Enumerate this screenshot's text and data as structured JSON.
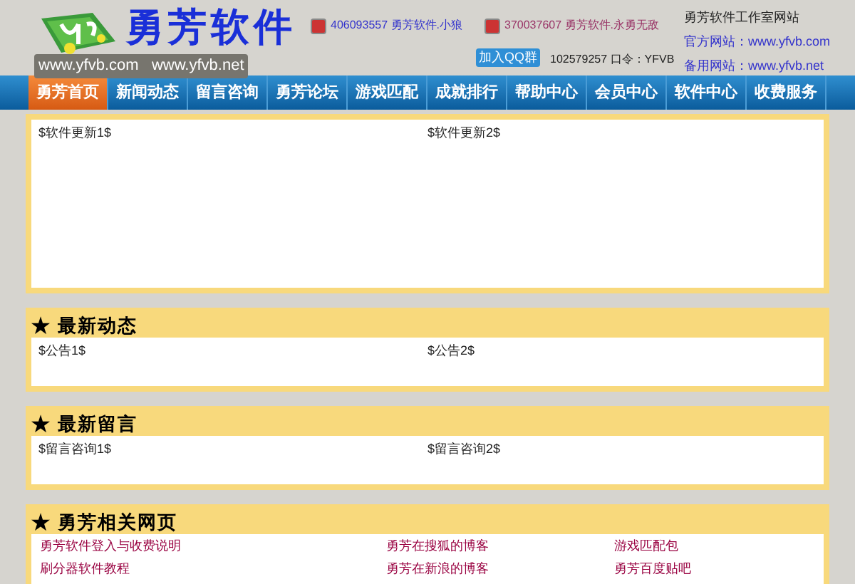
{
  "header": {
    "brand": "勇芳软件",
    "domains": "www.yfvb.com   www.yfvb.net",
    "qq_contacts": [
      {
        "number": "406093557",
        "name": "勇芳软件.小狼",
        "color": "#3333cc"
      },
      {
        "number": "370037607",
        "name": "勇芳软件.永勇无敌",
        "color": "#993366"
      }
    ],
    "qq_group": {
      "button": "加入QQ群",
      "text": "102579257 口令：YFVB"
    },
    "sites": {
      "title": "勇芳软件工作室网站",
      "lines": [
        {
          "label": "官方网站：",
          "url": "www.yfvb.com"
        },
        {
          "label": "备用网站：",
          "url": "www.yfvb.net"
        }
      ]
    }
  },
  "nav": [
    {
      "label": "勇芳首页",
      "selected": true
    },
    {
      "label": "新闻动态",
      "selected": false
    },
    {
      "label": "留言咨询",
      "selected": false
    },
    {
      "label": "勇芳论坛",
      "selected": false
    },
    {
      "label": "游戏匹配",
      "selected": false
    },
    {
      "label": "成就排行",
      "selected": false
    },
    {
      "label": "帮助中心",
      "selected": false
    },
    {
      "label": "会员中心",
      "selected": false
    },
    {
      "label": "软件中心",
      "selected": false
    },
    {
      "label": "收费服务",
      "selected": false
    }
  ],
  "sections": [
    {
      "kind": "plain",
      "items": [
        "$软件更新1$",
        "$软件更新2$"
      ]
    },
    {
      "kind": "titled",
      "title": "★ 最新动态",
      "items": [
        "$公告1$",
        "$公告2$"
      ]
    },
    {
      "kind": "titled",
      "title": "★ 最新留言",
      "items": [
        "$留言咨询1$",
        "$留言咨询2$"
      ]
    },
    {
      "kind": "links",
      "title": "★ 勇芳相关网页",
      "items": [
        "勇芳软件登入与收费说明",
        "勇芳在搜狐的博客",
        "游戏匹配包",
        "刷分器软件教程",
        "勇芳在新浪的博客",
        "勇芳百度贴吧"
      ]
    }
  ]
}
